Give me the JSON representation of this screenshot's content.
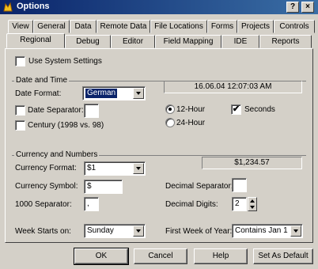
{
  "window": {
    "title": "Options",
    "help_glyph": "?",
    "close_glyph": "×"
  },
  "tabs_row1": [
    "View",
    "General",
    "Data",
    "Remote Data",
    "File Locations",
    "Forms",
    "Projects",
    "Controls"
  ],
  "tabs_row2": [
    "Regional",
    "Debug",
    "Editor",
    "Field Mapping",
    "IDE",
    "Reports"
  ],
  "active_tab": "Regional",
  "regional": {
    "use_system_settings": {
      "label": "Use System Settings",
      "checked": false
    },
    "date_time_group": "Date and Time",
    "date_format_label": "Date Format:",
    "date_format_value": "German",
    "datetime_preview": "16.06.04 12:07:03 AM",
    "date_separator_label": "Date Separator:",
    "date_separator_checked": false,
    "date_separator_value": "",
    "century_label": "Century (1998 vs. 98)",
    "century_checked": false,
    "hour12_label": "12-Hour",
    "hour12_selected": true,
    "hour24_label": "24-Hour",
    "hour24_selected": false,
    "seconds_label": "Seconds",
    "seconds_checked": true,
    "currency_group": "Currency and Numbers",
    "currency_preview": "$1,234.57",
    "currency_format_label": "Currency Format:",
    "currency_format_value": "$1",
    "currency_symbol_label": "Currency Symbol:",
    "currency_symbol_value": "$",
    "thousand_sep_label": "1000 Separator:",
    "thousand_sep_value": ",",
    "decimal_sep_label": "Decimal Separator:",
    "decimal_sep_value": "",
    "decimal_digits_label": "Decimal Digits:",
    "decimal_digits_value": "2",
    "week_starts_label": "Week Starts on:",
    "week_starts_value": "Sunday",
    "first_week_label": "First Week of Year:",
    "first_week_value": "Contains Jan 1"
  },
  "buttons": {
    "ok": "OK",
    "cancel": "Cancel",
    "help": "Help",
    "set_default": "Set As Default"
  },
  "colors": {
    "title_bar": "#0a246a",
    "face": "#d4d0c8"
  }
}
